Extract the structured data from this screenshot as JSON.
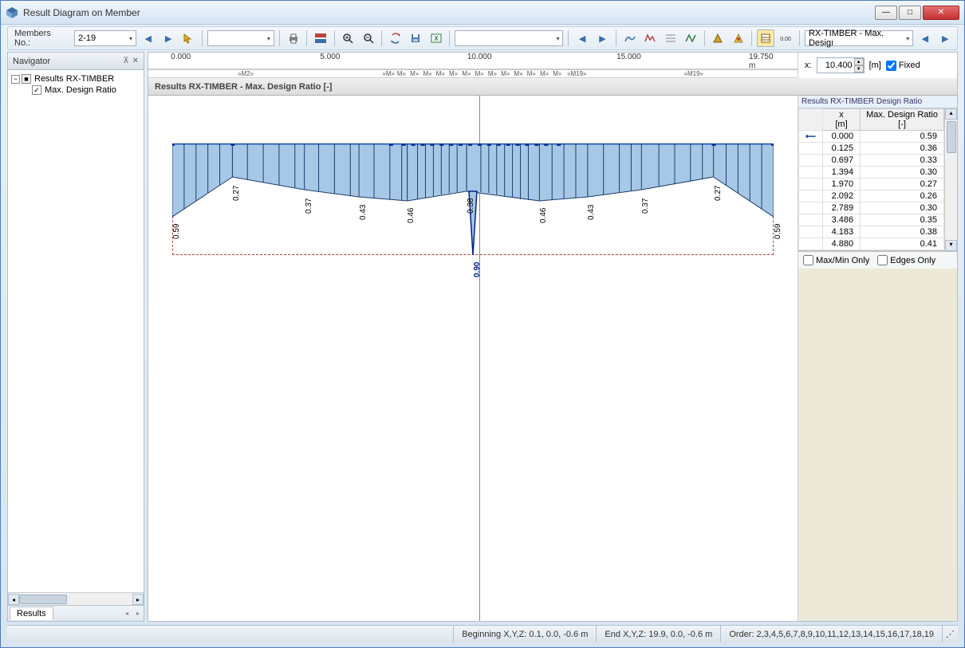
{
  "window": {
    "title": "Result Diagram on Member"
  },
  "toolbar": {
    "members_label": "Members No.:",
    "members_value": "2-19",
    "result_set": "RX-TIMBER -  Max. Desigı"
  },
  "navigator": {
    "title": "Navigator",
    "root": "Results RX-TIMBER",
    "item1": "Max. Design Ratio",
    "tab": "Results"
  },
  "ruler": {
    "ticks": [
      "0.000",
      "5.000",
      "10.000",
      "15.000",
      "19.750 m"
    ],
    "members": [
      "»M2»",
      "»M»",
      "M»",
      "M»",
      "M»",
      "M»",
      "M»",
      "M»",
      "M»",
      "M»",
      "M»",
      "M»",
      "M»",
      "M»",
      "M»",
      "»M19»",
      "»M19»"
    ]
  },
  "xpanel": {
    "label": "x:",
    "value": "10.400",
    "unit": "[m]",
    "fixed": "Fixed"
  },
  "chart": {
    "header": "Results RX-TIMBER - Max. Design Ratio [-]",
    "peak_label": "0.90",
    "value_labels": [
      {
        "pos": 0.0,
        "text": "0.59"
      },
      {
        "pos": 0.1,
        "text": "0.27"
      },
      {
        "pos": 0.22,
        "text": "0.37"
      },
      {
        "pos": 0.31,
        "text": "0.43"
      },
      {
        "pos": 0.39,
        "text": "0.46"
      },
      {
        "pos": 0.49,
        "text": "0.38"
      },
      {
        "pos": 0.61,
        "text": "0.46"
      },
      {
        "pos": 0.69,
        "text": "0.43"
      },
      {
        "pos": 0.78,
        "text": "0.37"
      },
      {
        "pos": 0.9,
        "text": "0.27"
      },
      {
        "pos": 1.0,
        "text": "0.59"
      }
    ]
  },
  "chart_data": {
    "type": "line",
    "title": "Results RX-TIMBER - Max. Design Ratio [-]",
    "xlabel": "x [m]",
    "ylabel": "Max. Design Ratio [-]",
    "xlim": [
      0,
      19.75
    ],
    "ylim": [
      0,
      0.9
    ],
    "x": [
      0.0,
      1.97,
      4.34,
      6.12,
      7.7,
      9.67,
      12.03,
      13.61,
      15.39,
      17.76,
      19.75
    ],
    "y": [
      0.59,
      0.27,
      0.37,
      0.43,
      0.46,
      0.38,
      0.46,
      0.43,
      0.37,
      0.27,
      0.59
    ],
    "peak": {
      "x": 9.875,
      "y": 0.9
    }
  },
  "right_panel": {
    "header": "Results RX-TIMBER  Design Ratio",
    "col_x": "x",
    "col_x_unit": "[m]",
    "col_r": "Max. Design Ratio",
    "col_r_unit": "[-]",
    "rows": [
      {
        "x": "0.000",
        "r": "0.59",
        "active": true
      },
      {
        "x": "0.125",
        "r": "0.36"
      },
      {
        "x": "0.697",
        "r": "0.33"
      },
      {
        "x": "1.394",
        "r": "0.30"
      },
      {
        "x": "1.970",
        "r": "0.27"
      },
      {
        "x": "2.092",
        "r": "0.26"
      },
      {
        "x": "2.789",
        "r": "0.30"
      },
      {
        "x": "3.486",
        "r": "0.35"
      },
      {
        "x": "4.183",
        "r": "0.38"
      },
      {
        "x": "4.880",
        "r": "0.41"
      }
    ],
    "maxmin": "Max/Min Only",
    "edges": "Edges Only"
  },
  "status": {
    "beginning": "Beginning X,Y,Z:   0.1, 0.0, -0.6 m",
    "end": "End X,Y,Z:   19.9, 0.0, -0.6 m",
    "order": "Order:   2,3,4,5,6,7,8,9,10,11,12,13,14,15,16,17,18,19"
  }
}
